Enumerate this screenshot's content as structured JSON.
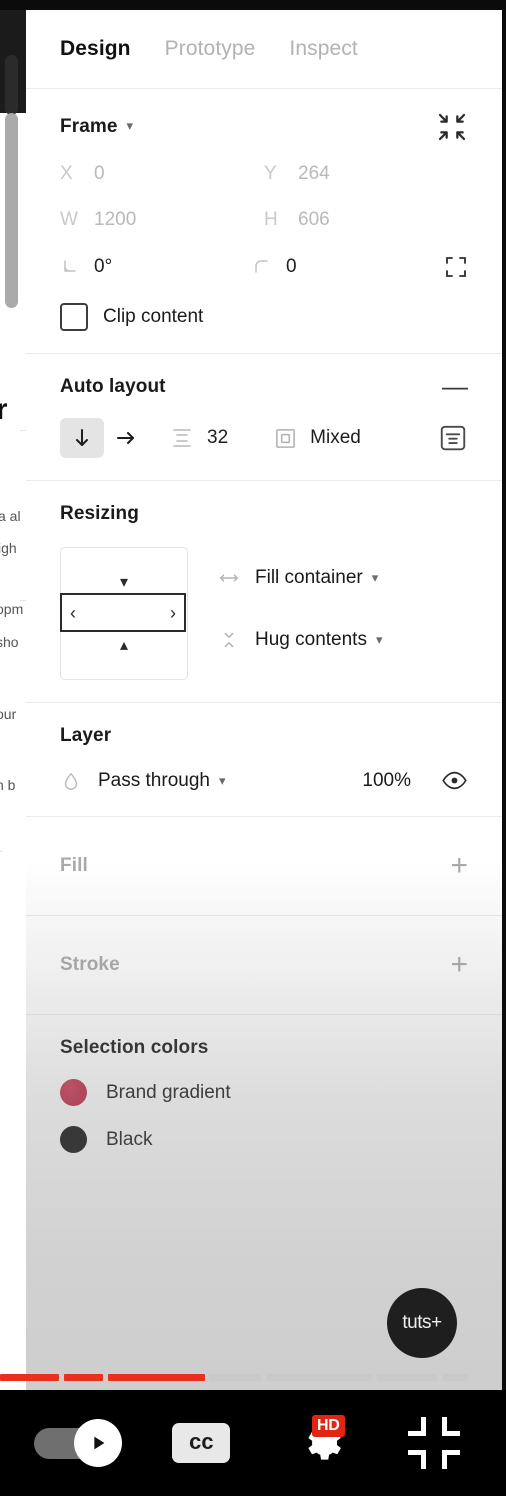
{
  "app": {
    "name": "figma-design-panel"
  },
  "tabs": [
    {
      "label": "Design",
      "active": true
    },
    {
      "label": "Prototype",
      "active": false
    },
    {
      "label": "Inspect",
      "active": false
    }
  ],
  "frame": {
    "title": "Frame",
    "collapse_icon": "collapse-arrows-icon",
    "x_label": "X",
    "x_value": "0",
    "y_label": "Y",
    "y_value": "264",
    "w_label": "W",
    "w_value": "1200",
    "h_label": "H",
    "h_value": "606",
    "rotation_value": "0°",
    "corner_radius_value": "0",
    "independent_corners_icon": "independent-corners-icon",
    "clip_content_label": "Clip content",
    "clip_content_checked": false
  },
  "auto_layout": {
    "title": "Auto layout",
    "remove_label": "—",
    "direction_vertical_selected": true,
    "gap_value": "32",
    "padding_value": "Mixed",
    "align_icon": "alignment-icon"
  },
  "resizing": {
    "title": "Resizing",
    "horizontal_value": "Fill container",
    "vertical_value": "Hug contents"
  },
  "layer": {
    "title": "Layer",
    "blend_mode": "Pass through",
    "opacity": "100%",
    "visible_icon": "eye-icon"
  },
  "fill": {
    "title": "Fill",
    "add_label": "+"
  },
  "stroke": {
    "title": "Stroke",
    "add_label": "+"
  },
  "selection_colors": {
    "title": "Selection colors",
    "items": [
      {
        "name": "Brand gradient",
        "color": "#C32B45"
      },
      {
        "name": "Black",
        "color": "#111111"
      }
    ]
  },
  "canvas_fragments": {
    "heading": "r",
    "lines": [
      "a al",
      "igh",
      "opm",
      "sho",
      "our",
      "h b",
      "."
    ]
  },
  "watermark": {
    "text": "tuts+"
  },
  "player": {
    "progress_percent": 41,
    "accent_color": "#EA2F1E",
    "autoplay_on": false,
    "captions_label": "cc",
    "quality_badge": "HD",
    "play_icon": "play-icon",
    "settings_icon": "gear-icon",
    "fullscreen_icon": "exit-fullscreen-icon"
  }
}
